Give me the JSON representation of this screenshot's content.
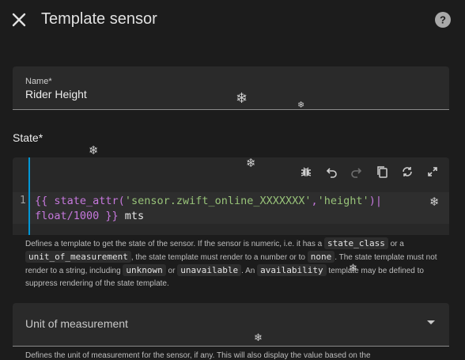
{
  "header": {
    "title": "Template sensor",
    "close_icon": "close-icon",
    "help_icon": "help-circle-icon"
  },
  "name_field": {
    "label": "Name*",
    "value": "Rider Height"
  },
  "state": {
    "heading": "State*",
    "toolbar_icons": [
      "bug-icon",
      "undo-icon",
      "redo-icon",
      "copy-icon",
      "refresh-icon",
      "fullscreen-icon"
    ],
    "line_number": "1",
    "code": {
      "open": "{{",
      "func": " state_attr(",
      "arg1": "'sensor.zwift_online_XXXXXXX'",
      "comma": ",",
      "arg2": "'height'",
      "rest": ")|\nfloat/1000 ",
      "close": "}}",
      "suffix": " mts"
    },
    "helper": {
      "t1": "Defines a template to get the state of the sensor. If the sensor is numeric, i.e. it has a ",
      "c1": "state_class",
      "t2": " or a ",
      "c2": "unit_of_measurement",
      "t3": ", the state template must render to a number or to ",
      "c3": "none",
      "t4": ". The state template must not render to a string, including ",
      "c4": "unknown",
      "t5": " or ",
      "c5": "unavailable",
      "t6": ". An ",
      "c6": "availability",
      "t7": " template may be defined to suppress rendering of the state template."
    }
  },
  "unit_field": {
    "label": "Unit of measurement"
  },
  "unit_helper": "Defines the unit of measurement for the sensor, if any. This will also display the value based on the"
}
